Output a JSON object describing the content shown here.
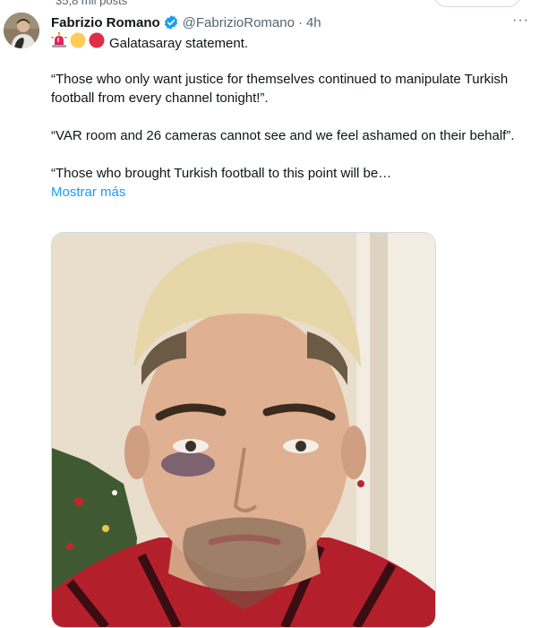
{
  "profile_header": {
    "posts_count": "35,8 mil posts"
  },
  "tweet": {
    "author_name": "Fabrizio Romano",
    "handle": "@FabrizioRomano",
    "separator": "·",
    "time": "4h",
    "more_menu": "···",
    "lead_text": "Galatasaray statement.",
    "paragraphs": [
      "“Those who only want justice for themselves continued to manipulate Turkish football from every channel tonight!”.",
      "“VAR room and 26 cameras cannot see and we feel ashamed on their behalf”.",
      "“Those who brought Turkish football to this point will be…"
    ],
    "show_more": "Mostrar más"
  },
  "colors": {
    "accent": "#1d9bf0",
    "text": "#0f1419",
    "secondary_text": "#536471",
    "border": "#cfd9de"
  },
  "icons": {
    "verified": "verified-badge-icon",
    "siren": "rotating-light-icon",
    "yellow_circle": "yellow-circle-icon",
    "red_circle": "red-circle-icon",
    "more": "ellipsis-icon"
  }
}
